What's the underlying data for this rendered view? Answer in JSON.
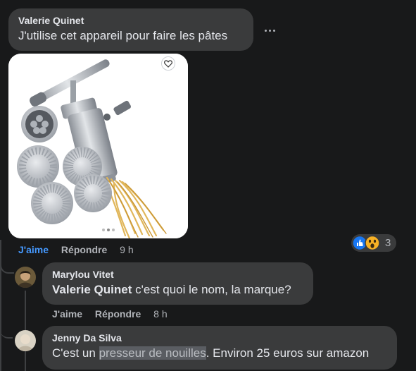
{
  "comment1": {
    "author": "Valerie Quinet",
    "text": "J'utilise cet appareil pour faire les pâtes",
    "like_label": "J'aime",
    "reply_label": "Répondre",
    "time": "9 h",
    "reaction_count": "3",
    "reaction_icons": [
      "like-icon",
      "wow-icon"
    ]
  },
  "reply1": {
    "author": "Marylou Vitet",
    "mention": "Valerie Quinet",
    "text": " c'est quoi le nom, la marque?",
    "like_label": "J'aime",
    "reply_label": "Répondre",
    "time": "8 h"
  },
  "reply2": {
    "author": "Jenny Da Silva",
    "text_before": "C'est un ",
    "text_highlight": "presseur de nouilles",
    "text_after": ". Environ 25 euros sur amazon"
  },
  "colors": {
    "background": "#18191a",
    "bubble": "#3a3b3c",
    "like_blue": "#4599ff",
    "secondary_text": "#b0b3b8"
  }
}
